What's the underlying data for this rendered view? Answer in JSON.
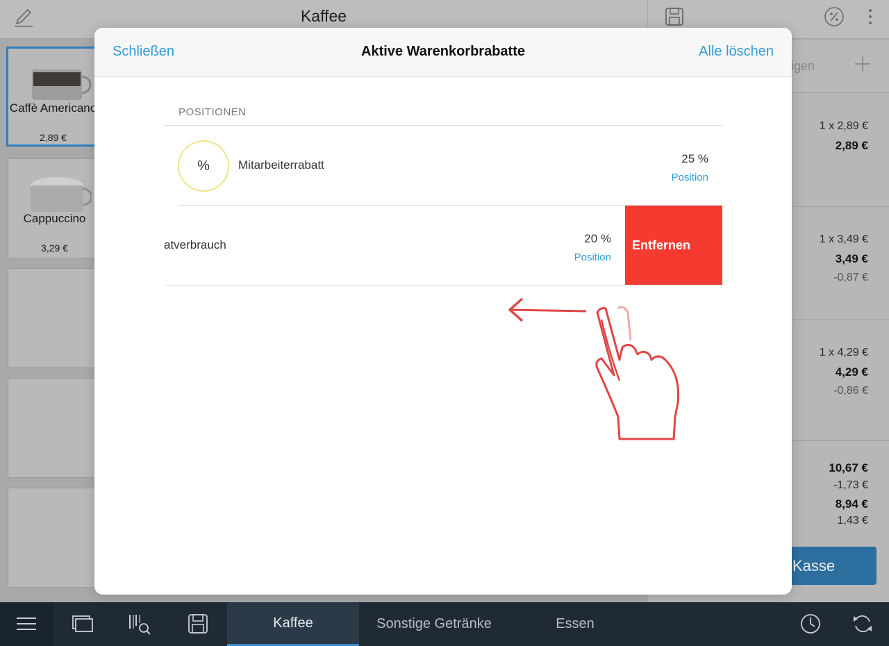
{
  "app": {
    "category_title": "Kaffee",
    "products": [
      {
        "name": "Caffè Americano",
        "price": "2,89 €",
        "selected": true
      },
      {
        "name": "Cappuccino",
        "price": "3,29 €",
        "selected": false
      }
    ],
    "cart": {
      "header_hint": "igen",
      "items": [
        {
          "qty_price": "1 x 2,89 €",
          "total": "2,89 €",
          "discount": ""
        },
        {
          "qty_price": "1 x 3,49 €",
          "total": "3,49 €",
          "discount": "-0,87 €"
        },
        {
          "qty_price": "1 x 4,29 €",
          "total": "4,29 €",
          "discount": "-0,86 €"
        }
      ],
      "totals": {
        "subtotal": "10,67 €",
        "discount": "-1,73 €",
        "total": "8,94 €",
        "tax": "1,43 €"
      },
      "checkout_label": "Kasse"
    }
  },
  "tabbar": {
    "tabs": [
      {
        "label": "Kaffee",
        "active": true
      },
      {
        "label": "Sonstige Getränke",
        "active": false
      },
      {
        "label": "Essen",
        "active": false
      }
    ]
  },
  "modal": {
    "close_label": "Schließen",
    "title": "Aktive Warenkorbrabatte",
    "clear_all_label": "Alle löschen",
    "section_label": "POSITIONEN",
    "discounts": [
      {
        "badge": "%",
        "name": "Mitarbeiterrabatt",
        "percent": "25 %",
        "scope": "Position"
      },
      {
        "name": "atverbrauch",
        "percent": "20 %",
        "scope": "Position",
        "action_label": "Entfernen"
      }
    ]
  },
  "colors": {
    "accent": "#2e9bd6",
    "danger": "#f53a30",
    "badge_ring": "#f1e38a",
    "tabbar_bg": "#1f2a35",
    "checkout": "#2c6f9f",
    "gesture": "#e04646"
  },
  "icons": {
    "edit": "pencil-icon",
    "save": "floppy-disk-icon",
    "discount": "percent-circle-icon",
    "more": "more-vertical-icon",
    "add": "plus-icon",
    "menu": "hamburger-menu-icon",
    "screens": "screens-icon",
    "barcode_search": "barcode-search-icon",
    "save_bottom": "floppy-disk-icon",
    "clock": "clock-icon",
    "sync": "sync-icon",
    "gesture": "swipe-left-hand-icon"
  }
}
